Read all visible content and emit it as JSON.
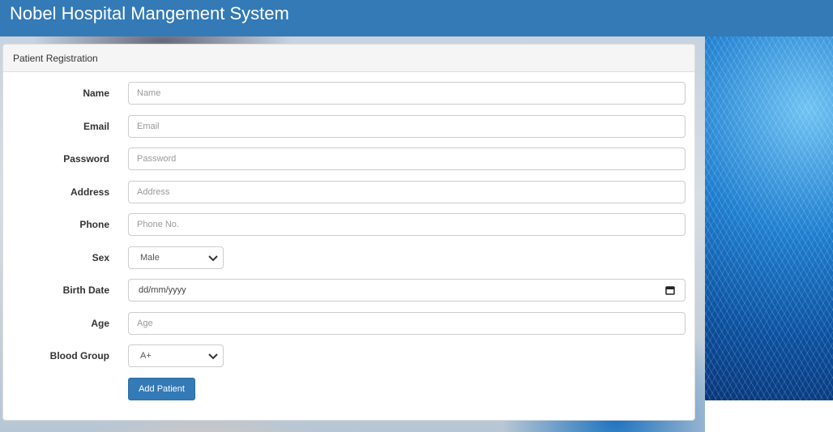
{
  "app": {
    "title": "Nobel Hospital Mangement System"
  },
  "panel": {
    "heading": "Patient Registration"
  },
  "form": {
    "name": {
      "label": "Name",
      "placeholder": "Name",
      "value": ""
    },
    "email": {
      "label": "Email",
      "placeholder": "Email",
      "value": ""
    },
    "password": {
      "label": "Password",
      "placeholder": "Password",
      "value": ""
    },
    "address": {
      "label": "Address",
      "placeholder": "Address",
      "value": ""
    },
    "phone": {
      "label": "Phone",
      "placeholder": "Phone No.",
      "value": ""
    },
    "sex": {
      "label": "Sex",
      "selected": "Male"
    },
    "birth_date": {
      "label": "Birth Date",
      "display": "dd/mm/yyyy"
    },
    "age": {
      "label": "Age",
      "placeholder": "Age",
      "value": ""
    },
    "blood_group": {
      "label": "Blood Group",
      "selected": "A+"
    },
    "submit_label": "Add Patient"
  },
  "icons": {
    "select_arrow": "chevron-down-icon",
    "date_picker": "calendar-icon"
  },
  "colors": {
    "header_bg": "#337ab7",
    "button_bg": "#337ab7",
    "panel_heading_bg": "#f5f5f5"
  }
}
